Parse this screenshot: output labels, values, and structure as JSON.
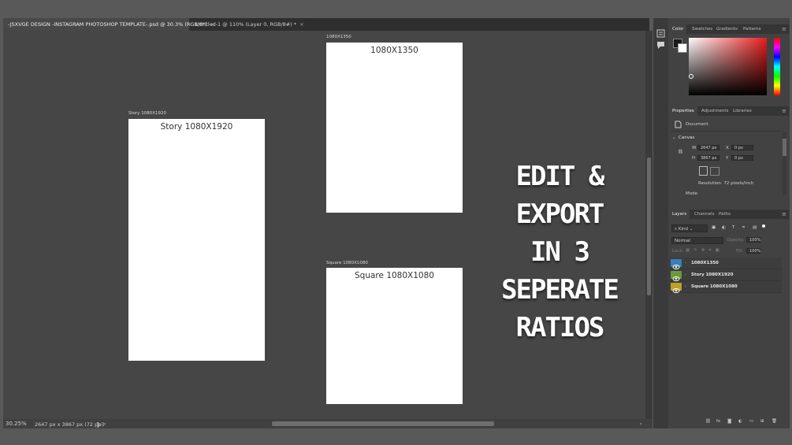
{
  "tabs": [
    {
      "label": "-JSXVGE DESIGN -INSTAGRAM PHOTOSHOP TEMPLATE-.psd @ 30.3% (RGB/8*)",
      "close": "×",
      "active": true
    },
    {
      "label": "Untitled-1 @ 110% (Layer 0, RGB/8#) *",
      "close": "×",
      "active": false
    }
  ],
  "artboards": {
    "story": {
      "label": "Story 1080X1920",
      "title": "Story 1080X1920"
    },
    "portrait": {
      "label": "1080X1350",
      "title": "1080X1350"
    },
    "square": {
      "label": "Square 1080X1080",
      "title": "Square 1080X1080"
    }
  },
  "overlay": {
    "line1": "EDIT & EXPORT",
    "line2": "IN 3 SEPERATE",
    "line3": "RATIOS"
  },
  "status": {
    "zoom": "30.25%",
    "doc_info": "2647 px x 3867 px (72 ppi)",
    "arrow": "❯",
    "left_arrow": "‹",
    "right_arrow": "›"
  },
  "color_panel": {
    "tabs": [
      "Color",
      "Swatches",
      "Gradients",
      "Patterns"
    ],
    "menu": "≡"
  },
  "properties_panel": {
    "tabs": [
      "Properties",
      "Adjustments",
      "Libraries"
    ],
    "menu": "≡",
    "doc_label": "Document",
    "canvas_label": "Canvas",
    "w_label": "W",
    "w_value": "2647 px",
    "h_label": "H",
    "h_value": "3867 px",
    "x_label": "X",
    "x_value": "0 px",
    "y_label": "Y",
    "y_value": "0 px",
    "resolution": "Resolution: 72 pixels/inch",
    "mode_label": "Mode"
  },
  "layers_panel": {
    "tabs": [
      "Layers",
      "Channels",
      "Paths"
    ],
    "menu": "≡",
    "kind": "Kind",
    "blend": "Normal",
    "opacity_label": "Opacity:",
    "opacity_value": "100%",
    "lock_label": "Lock:",
    "fill_label": "Fill:",
    "fill_value": "100%",
    "layers": [
      {
        "name": "1080X1350",
        "color": "#3b7fb8"
      },
      {
        "name": "Story 1080X1920",
        "color": "#6a9a3a"
      },
      {
        "name": "Square 1080X1080",
        "color": "#b8a22a"
      }
    ]
  }
}
